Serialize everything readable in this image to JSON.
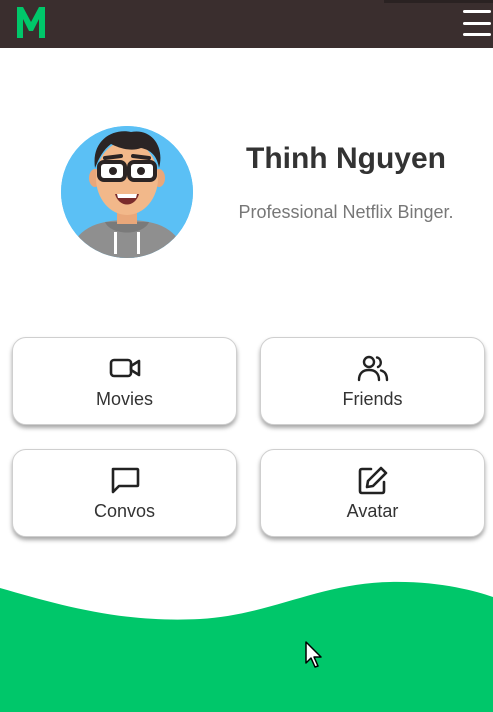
{
  "app": {
    "logo_letter": "M",
    "brand_color": "#00c76a",
    "topbar_color": "#3a2e2e"
  },
  "profile": {
    "name": "Thinh Nguyen",
    "tagline": "Professional Netflix Binger.",
    "avatar_icon": "cartoon-avatar"
  },
  "cards": [
    {
      "label": "Movies",
      "icon": "video-camera-icon"
    },
    {
      "label": "Friends",
      "icon": "users-icon"
    },
    {
      "label": "Convos",
      "icon": "message-square-icon"
    },
    {
      "label": "Avatar",
      "icon": "edit-icon"
    }
  ]
}
